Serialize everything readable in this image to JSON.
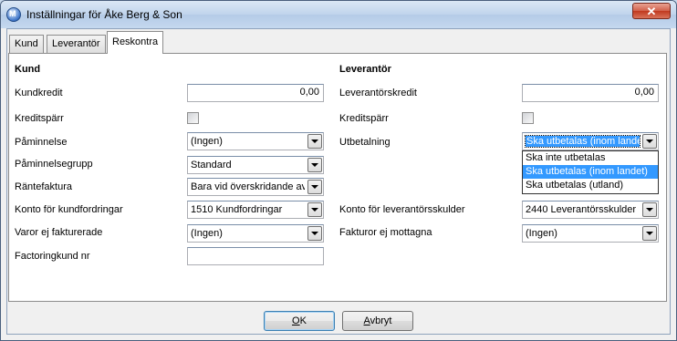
{
  "window": {
    "title": "Inställningar för Åke Berg & Son",
    "close_glyph": "✕"
  },
  "tabs": [
    {
      "label": "Kund"
    },
    {
      "label": "Leverantör"
    },
    {
      "label": "Reskontra"
    }
  ],
  "kund": {
    "heading": "Kund",
    "kundkredit_label": "Kundkredit",
    "kundkredit_value": "0,00",
    "kreditsparr_label": "Kreditspärr",
    "paminnelse_label": "Påminnelse",
    "paminnelse_value": "(Ingen)",
    "paminnelsegrupp_label": "Påminnelsegrupp",
    "paminnelsegrupp_value": "Standard",
    "rantefaktura_label": "Räntefaktura",
    "rantefaktura_value": "Bara vid överskridande av",
    "konto_label": "Konto för kundfordringar",
    "konto_value": "1510 Kundfordringar",
    "varor_label": "Varor ej fakturerade",
    "varor_value": "(Ingen)",
    "factoring_label": "Factoringkund nr",
    "factoring_value": ""
  },
  "leverantor": {
    "heading": "Leverantör",
    "kredit_label": "Leverantörskredit",
    "kredit_value": "0,00",
    "kreditsparr_label": "Kreditspärr",
    "utbetalning_label": "Utbetalning",
    "utbetalning_value": "Ska utbetalas (inom landet)",
    "utbetalning_options": [
      "Ska inte utbetalas",
      "Ska utbetalas (inom landet)",
      "Ska utbetalas (utland)"
    ],
    "konto_label": "Konto för leverantörsskulder",
    "konto_value": "2440 Leverantörsskulder",
    "fakturor_label": "Fakturor ej mottagna",
    "fakturor_value": "(Ingen)"
  },
  "buttons": {
    "ok_mnemonic": "O",
    "ok_rest": "K",
    "avbryt_mnemonic": "A",
    "avbryt_rest": "vbryt"
  }
}
